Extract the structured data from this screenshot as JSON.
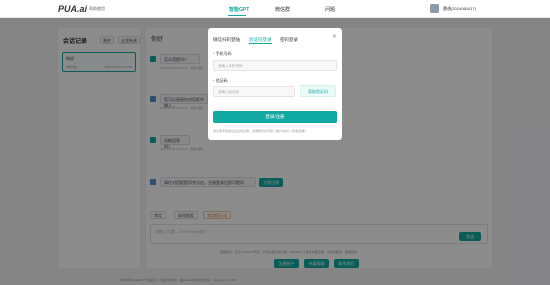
{
  "header": {
    "logo": "PUA.ai",
    "logo_sub": "帮助使用",
    "nav": [
      "智能GPT",
      "微信群",
      "问题"
    ],
    "username": "靠谱(2024060417)"
  },
  "sidebar": {
    "title": "会话记录",
    "btn_delete": "删除",
    "btn_new": "这里新建",
    "item_title": "你好",
    "item_meta": "0条对话",
    "item_date": "2023-06-06 16:11:29"
  },
  "main": {
    "title": "你好",
    "messages": [
      {
        "text": "怎么用提问?",
        "meta": "2023-06-06 16:11:29 · 复制/编辑"
      },
      {
        "text": "您可以直接在对话框中输入...",
        "meta": "2023-06-06 16:11:29 · 复制/编辑"
      },
      {
        "text": "还能回答吗?",
        "meta": "2023-06-06 16:11:29 · 复制/编辑"
      },
      {
        "text": "请在对话框提问并点击，注册登录后即可提问",
        "meta": "2023-06-06 16:11:29"
      }
    ],
    "register_btn": "立即注册",
    "tabs": [
      "常用",
      "联网搜索",
      "常用提示词"
    ],
    "input_placeholder": "请输入问题，Shift+Enter换行",
    "send_btn": "发送",
    "disclaimer": "温馨提示：基于ChatGPT开发，不代表我们的立场。ChatGPT 不保证内容正确，请注意甄别，谨慎使用。",
    "bottom_btns": [
      "注册账户",
      "充值帮助",
      "联系我们"
    ]
  },
  "modal": {
    "tabs": [
      "微信扫码登陆",
      "验证码登录",
      "密码登录"
    ],
    "phone_label": "手机号码",
    "phone_placeholder": "请输入手机号码",
    "code_label": "验证码",
    "code_placeholder": "请输入验证码",
    "code_btn": "获取验证码",
    "login_btn": "登录/注册",
    "terms": "未注册手机验证后自动注册，注册即代表同意《用户协议》《隐私政策》"
  },
  "footer": "本站使用ChatGPT开发接口 · 内容仅供参考 · 由PUA.ai提供技术支持 · Copyright © 2023"
}
